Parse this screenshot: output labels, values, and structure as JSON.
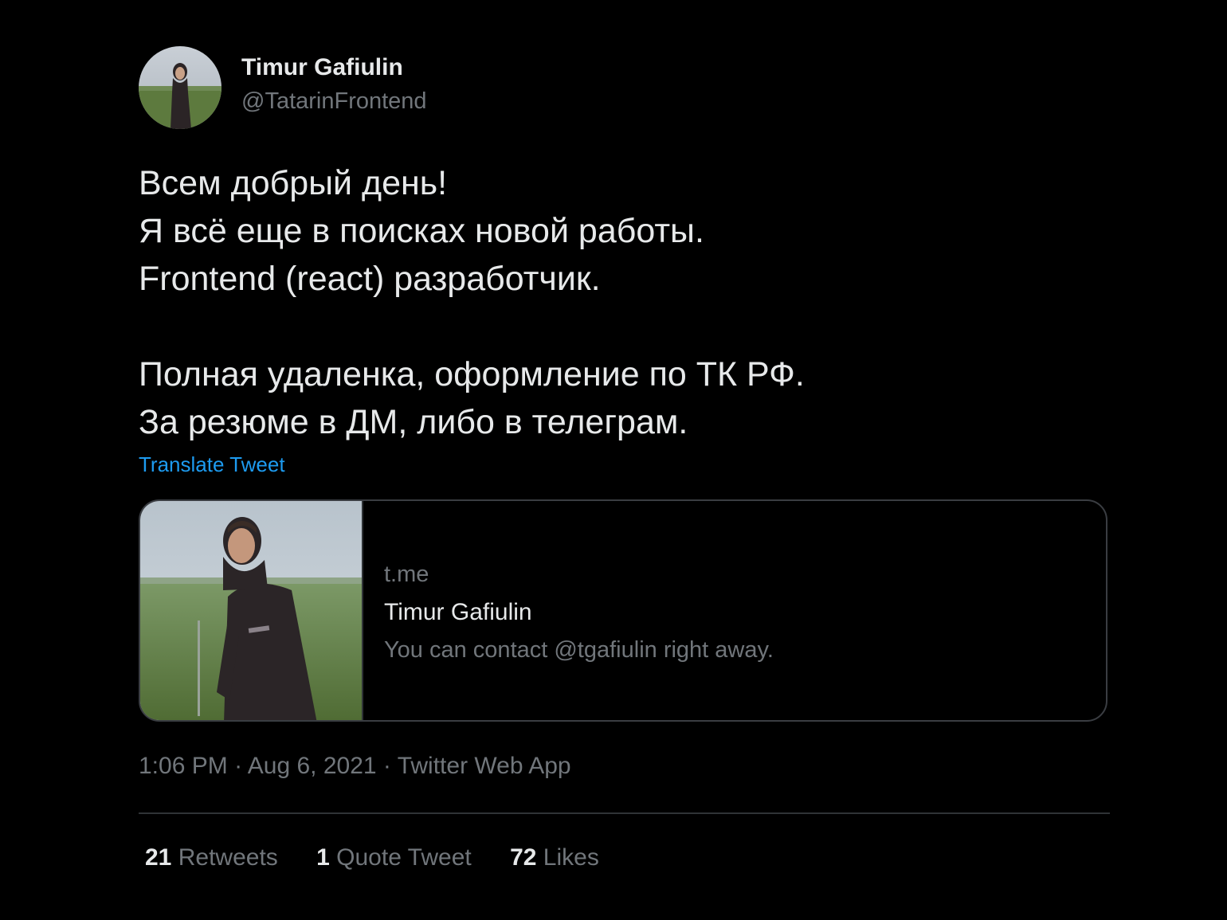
{
  "author": {
    "display_name": "Timur Gafiulin",
    "handle": "@TatarinFrontend"
  },
  "tweet": {
    "lines": [
      "Всем добрый день!",
      "Я всё еще в поисках новой работы.",
      "Frontend (react) разработчик.",
      "",
      "Полная удаленка, оформление по ТК РФ.",
      "За резюме в ДМ, либо в телеграм."
    ],
    "translate_label": "Translate Tweet"
  },
  "link_card": {
    "domain": "t.me",
    "title": "Timur Gafiulin",
    "description": "You can contact @tgafiulin right away."
  },
  "meta": {
    "time": "1:06 PM",
    "separator": "·",
    "date": "Aug 6, 2021",
    "source": "Twitter Web App"
  },
  "stats": {
    "retweets": {
      "count": "21",
      "label": "Retweets"
    },
    "quotes": {
      "count": "1",
      "label": "Quote Tweet"
    },
    "likes": {
      "count": "72",
      "label": "Likes"
    }
  },
  "colors": {
    "background": "#000000",
    "text_primary": "#e7e9ea",
    "text_secondary": "#71767b",
    "link": "#1d9bf0",
    "border": "#2f3336"
  }
}
